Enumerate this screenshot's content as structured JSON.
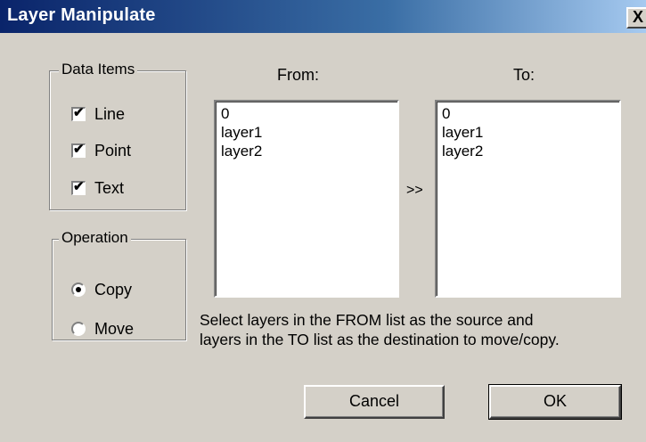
{
  "window": {
    "title": "Layer Manipulate",
    "close_label": "X"
  },
  "data_items": {
    "legend": "Data Items",
    "items": [
      {
        "label": "Line",
        "checked": true
      },
      {
        "label": "Point",
        "checked": true
      },
      {
        "label": "Text",
        "checked": true
      }
    ]
  },
  "operation": {
    "legend": "Operation",
    "options": [
      {
        "label": "Copy",
        "selected": true
      },
      {
        "label": "Move",
        "selected": false
      }
    ]
  },
  "from": {
    "label": "From:",
    "items": [
      "0",
      "layer1",
      "layer2"
    ]
  },
  "to": {
    "label": "To:",
    "items": [
      "0",
      "layer1",
      "layer2"
    ]
  },
  "arrow_label": ">>",
  "help_lines": [
    "Select layers in the FROM list as the source and",
    "layers in the TO list as the destination to move/copy."
  ],
  "buttons": {
    "cancel": "Cancel",
    "ok": "OK"
  }
}
